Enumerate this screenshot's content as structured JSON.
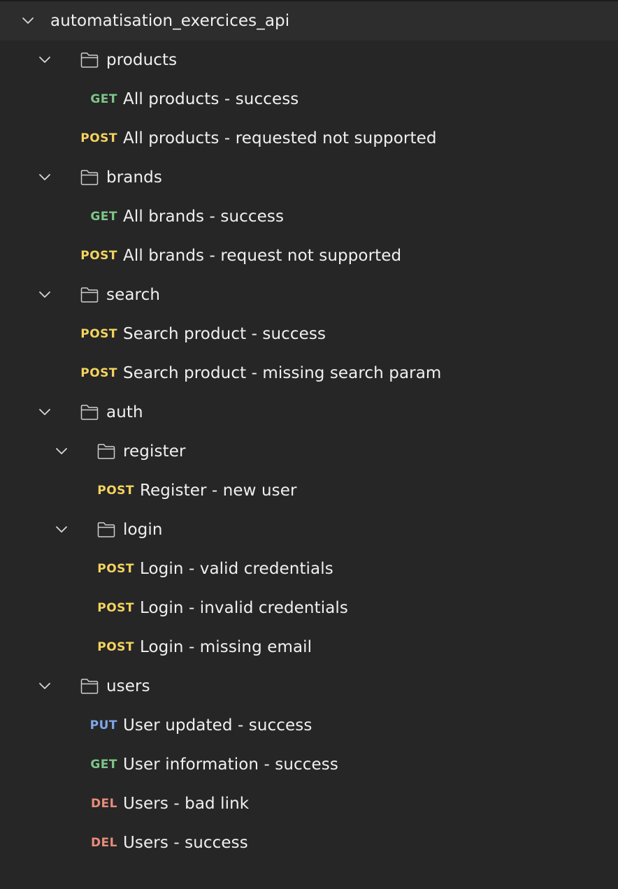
{
  "collection": {
    "name": "automatisation_exercices_api"
  },
  "colors": {
    "GET": "#7ec68a",
    "POST": "#f4d35e",
    "PUT": "#7fa6e8",
    "DEL": "#e88c7a"
  },
  "tree": [
    {
      "kind": "folder",
      "label": "products",
      "depth": 1
    },
    {
      "kind": "request",
      "method": "GET",
      "label": "All products - success",
      "depth": 1
    },
    {
      "kind": "request",
      "method": "POST",
      "label": "All products - requested not supported",
      "depth": 1
    },
    {
      "kind": "folder",
      "label": "brands",
      "depth": 1
    },
    {
      "kind": "request",
      "method": "GET",
      "label": "All brands - success",
      "depth": 1
    },
    {
      "kind": "request",
      "method": "POST",
      "label": "All brands - request not supported",
      "depth": 1
    },
    {
      "kind": "folder",
      "label": "search",
      "depth": 1
    },
    {
      "kind": "request",
      "method": "POST",
      "label": "Search product - success",
      "depth": 1
    },
    {
      "kind": "request",
      "method": "POST",
      "label": "Search product - missing search param",
      "depth": 1
    },
    {
      "kind": "folder",
      "label": "auth",
      "depth": 1
    },
    {
      "kind": "folder",
      "label": "register",
      "depth": 2
    },
    {
      "kind": "request",
      "method": "POST",
      "label": "Register - new user",
      "depth": 2
    },
    {
      "kind": "folder",
      "label": "login",
      "depth": 2
    },
    {
      "kind": "request",
      "method": "POST",
      "label": "Login - valid credentials",
      "depth": 2
    },
    {
      "kind": "request",
      "method": "POST",
      "label": "Login - invalid credentials",
      "depth": 2
    },
    {
      "kind": "request",
      "method": "POST",
      "label": "Login - missing email",
      "depth": 2
    },
    {
      "kind": "folder",
      "label": "users",
      "depth": 1
    },
    {
      "kind": "request",
      "method": "PUT",
      "label": "User updated - success",
      "depth": 1
    },
    {
      "kind": "request",
      "method": "GET",
      "label": "User information - success",
      "depth": 1
    },
    {
      "kind": "request",
      "method": "DEL",
      "label": "Users - bad link",
      "depth": 1
    },
    {
      "kind": "request",
      "method": "DEL",
      "label": "Users - success",
      "depth": 1
    }
  ]
}
